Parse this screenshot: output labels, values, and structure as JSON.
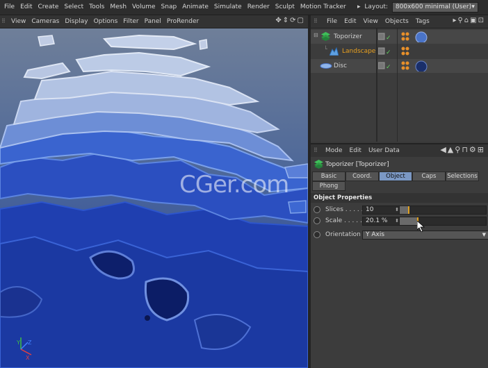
{
  "menubar": {
    "items": [
      "File",
      "Edit",
      "Create",
      "Select",
      "Tools",
      "Mesh",
      "Volume",
      "Snap",
      "Animate",
      "Simulate",
      "Render",
      "Sculpt",
      "Motion Tracker"
    ],
    "layout_label": "Layout:",
    "layout_value": "800x600 minimal (User)"
  },
  "viewport": {
    "menu": [
      "View",
      "Cameras",
      "Display",
      "Options",
      "Filter",
      "Panel",
      "ProRender"
    ],
    "axis_labels": {
      "y": "Y",
      "z": "Z",
      "x": "X"
    }
  },
  "object_manager": {
    "menu": [
      "File",
      "Edit",
      "View",
      "Objects",
      "Tags"
    ],
    "objects": [
      {
        "name": "Toporizer",
        "color": "#e8a020",
        "icon": "toporizer-icon"
      },
      {
        "name": "Landscape",
        "color": "#e8a020",
        "icon": "landscape-icon"
      },
      {
        "name": "Disc",
        "color": "#d0d0d0",
        "icon": "disc-icon"
      }
    ]
  },
  "attribute_manager": {
    "menu": [
      "Mode",
      "Edit",
      "User Data"
    ],
    "title": "Toporizer [Toporizer]",
    "tabs": [
      "Basic",
      "Coord.",
      "Object",
      "Caps",
      "Selections",
      "Phong"
    ],
    "active_tab": "Object",
    "section": "Object Properties",
    "properties": {
      "slices_label": "Slices . . . . .",
      "slices_value": "10",
      "slices_fill": 0.1,
      "scale_label": "Scale . . . . .",
      "scale_value": "20.1 %",
      "scale_fill": 0.201,
      "orientation_label": "Orientation",
      "orientation_value": "Y Axis"
    }
  },
  "watermark": "CGer.com",
  "colors": {
    "accent": "#7b98c4",
    "highlight": "#e8a020"
  }
}
